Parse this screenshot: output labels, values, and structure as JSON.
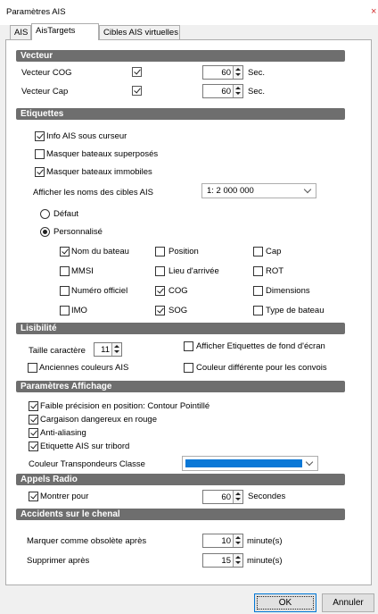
{
  "window": {
    "title": "Paramètres AIS",
    "close": "×"
  },
  "tabs": [
    {
      "label": "AIS"
    },
    {
      "label": "AisTargets"
    },
    {
      "label": "Cibles AIS virtuelles"
    }
  ],
  "vecteur": {
    "header": "Vecteur",
    "cog_label": "Vecteur COG",
    "cog_value": "60",
    "cog_unit": "Sec.",
    "cap_label": "Vecteur Cap",
    "cap_value": "60",
    "cap_unit": "Sec."
  },
  "etiquettes": {
    "header": "Etiquettes",
    "info_cursor": "Info AIS sous curseur",
    "hide_overlap": "Masquer bateaux superposés",
    "hide_still": "Masquer bateaux immobiles",
    "show_names_label": "Afficher les noms des cibles AIS",
    "scale_value": "1: 2 000 000",
    "radio_default": "Défaut",
    "radio_custom": "Personnalisé",
    "fields": {
      "name": "Nom du bateau",
      "position": "Position",
      "cap": "Cap",
      "mmsi": "MMSI",
      "arrival": "Lieu d'arrivée",
      "rot": "ROT",
      "official": "Numéro officiel",
      "cog": "COG",
      "dimensions": "Dimensions",
      "imo": "IMO",
      "sog": "SOG",
      "type": "Type de bateau"
    }
  },
  "lisibilite": {
    "header": "Lisibilité",
    "font_size_label": "Taille caractère",
    "font_size_value": "11",
    "bg_labels": "Afficher Etiquettes de fond d'écran",
    "old_colors": "Anciennes couleurs AIS",
    "convoy_color": "Couleur différente pour les convois"
  },
  "affichage": {
    "header": "Paramètres Affichage",
    "low_precision": "Faible précision en position: Contour Pointillé",
    "dangerous_cargo": "Cargaison dangereux en rouge",
    "antialiasing": "Anti-aliasing",
    "starboard_label": "Etiquette AIS sur tribord",
    "transponder_label": "Couleur Transpondeurs Classe",
    "transponder_color": "#0a78d7"
  },
  "radio": {
    "header": "Appels Radio",
    "show_for": "Montrer pour",
    "value": "60",
    "unit": "Secondes"
  },
  "accidents": {
    "header": "Accidents sur le chenal",
    "mark_obsolete": "Marquer comme obsolète après",
    "mark_value": "10",
    "mark_unit": "minute(s)",
    "delete_after": "Supprimer après",
    "delete_value": "15",
    "delete_unit": "minute(s)"
  },
  "footer": {
    "ok": "OK",
    "cancel": "Annuler"
  }
}
